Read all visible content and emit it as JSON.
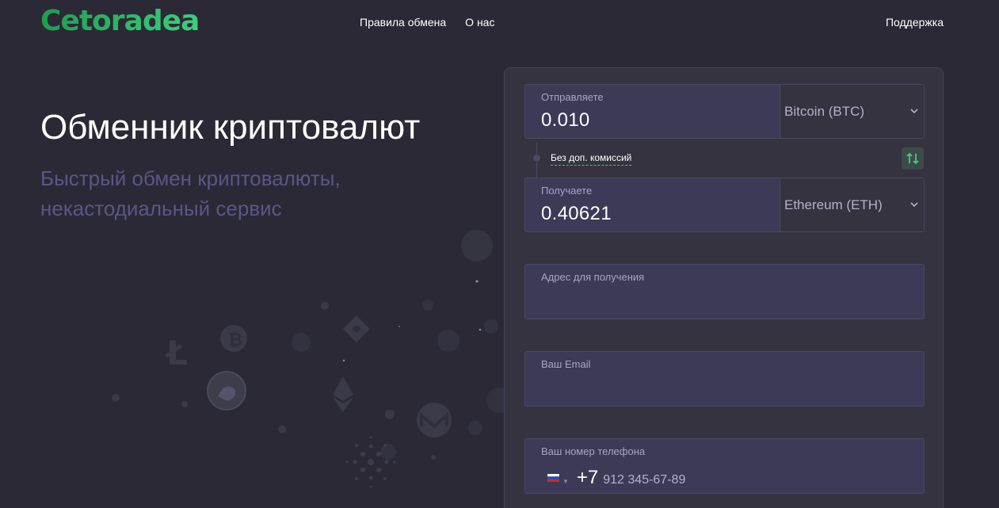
{
  "header": {
    "logo": "Cetoradea",
    "nav": [
      "Правила обмена",
      "О нас"
    ],
    "support": "Поддержка"
  },
  "hero": {
    "title": "Обменник криптовалют",
    "subtitle": "Быстрый обмен криптовалюты, некастодиальный сервис"
  },
  "exchange": {
    "send": {
      "label": "Отправляете",
      "amount": "0.010",
      "currency": "Bitcoin (BTC)"
    },
    "receive": {
      "label": "Получаете",
      "amount": "0.40621",
      "currency": "Ethereum (ETH)"
    },
    "fee_note": "Без доп. комиссий",
    "swap_icon": "swap-arrows-icon"
  },
  "form": {
    "address": {
      "label": "Адрес для получения",
      "value": ""
    },
    "email": {
      "label": "Ваш Email",
      "value": ""
    },
    "phone": {
      "label": "Ваш номер телефона",
      "country": "RU",
      "code": "+7",
      "placeholder": "912 345-67-89"
    }
  },
  "colors": {
    "background": "#2a2935",
    "accent": "#3ccf7e",
    "card": "#34333f",
    "field": "#3c3a57",
    "subtitle": "#5a5689"
  }
}
